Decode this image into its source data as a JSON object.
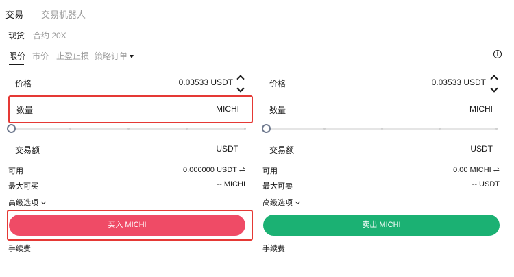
{
  "top_tabs": {
    "trade": "交易",
    "bot": "交易机器人"
  },
  "market_tabs": {
    "spot": "现货",
    "contract": "合约 20X"
  },
  "order_tabs": {
    "limit": "限价",
    "market": "市价",
    "tpsl": "止盈止损",
    "strategy": "策略订单"
  },
  "buy": {
    "price_label": "价格",
    "price_value": "0.03533 USDT",
    "qty_label": "数量",
    "qty_unit": "MICHI",
    "amount_label": "交易额",
    "amount_unit": "USDT",
    "available_label": "可用",
    "available_value": "0.000000 USDT ⇌",
    "max_label": "最大可买",
    "max_value": "-- MICHI",
    "advanced": "高级选项",
    "button": "买入 MICHI",
    "fee": "手续费"
  },
  "sell": {
    "price_label": "价格",
    "price_value": "0.03533 USDT",
    "qty_label": "数量",
    "qty_unit": "MICHI",
    "amount_label": "交易额",
    "amount_unit": "USDT",
    "available_label": "可用",
    "available_value": "0.00 MICHI ⇌",
    "max_label": "最大可卖",
    "max_value": "-- USDT",
    "advanced": "高级选项",
    "button": "卖出 MICHI",
    "fee": "手续费"
  },
  "colors": {
    "buy": "#ef4b66",
    "sell": "#1bb173",
    "highlight": "#e53935"
  }
}
